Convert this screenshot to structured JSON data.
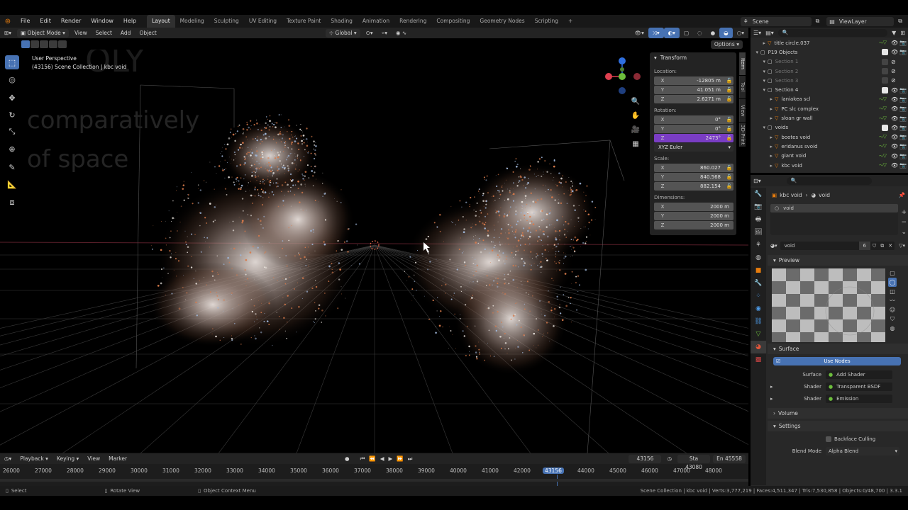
{
  "menu": [
    "File",
    "Edit",
    "Render",
    "Window",
    "Help"
  ],
  "workspaces": [
    "Layout",
    "Modeling",
    "Sculpting",
    "UV Editing",
    "Texture Paint",
    "Shading",
    "Animation",
    "Rendering",
    "Compositing",
    "Geometry Nodes",
    "Scripting",
    "+"
  ],
  "scene_name": "Scene",
  "view_layer": "ViewLayer",
  "header": {
    "mode": "Object Mode",
    "items": [
      "View",
      "Select",
      "Add",
      "Object"
    ],
    "orientation": "Global",
    "options": "Options"
  },
  "viewport": {
    "perspective": "User Perspective",
    "collection": "(43156) Scene Collection | kbc void",
    "bg_text_1": "OLY",
    "bg_text_2": "comparatively",
    "bg_text_3": "of space"
  },
  "transform": {
    "title": "Transform",
    "location_label": "Location:",
    "location": [
      {
        "ax": "X",
        "v": "-12805 m"
      },
      {
        "ax": "Y",
        "v": "41.051 m"
      },
      {
        "ax": "Z",
        "v": "2.6271 m"
      }
    ],
    "rotation_label": "Rotation:",
    "rotation": [
      {
        "ax": "X",
        "v": "0°"
      },
      {
        "ax": "Y",
        "v": "0°"
      },
      {
        "ax": "Z",
        "v": "2473°"
      }
    ],
    "rotation_mode": "XYZ Euler",
    "scale_label": "Scale:",
    "scale": [
      {
        "ax": "X",
        "v": "860.027"
      },
      {
        "ax": "Y",
        "v": "840.568"
      },
      {
        "ax": "Z",
        "v": "882.154"
      }
    ],
    "dimensions_label": "Dimensions:",
    "dimensions": [
      {
        "ax": "X",
        "v": "2000 m"
      },
      {
        "ax": "Y",
        "v": "2000 m"
      },
      {
        "ax": "Z",
        "v": "2000 m"
      }
    ]
  },
  "side_tabs": [
    "Item",
    "Tool",
    "View",
    "3D-Print"
  ],
  "outliner": [
    {
      "name": "title circle.037",
      "indent": 2,
      "dim": false
    },
    {
      "name": "P19 Objects",
      "indent": 1,
      "dim": false
    },
    {
      "name": "Section 1",
      "indent": 2,
      "dim": true
    },
    {
      "name": "Section 2",
      "indent": 2,
      "dim": true
    },
    {
      "name": "Section 3",
      "indent": 2,
      "dim": true
    },
    {
      "name": "Section 4",
      "indent": 2,
      "dim": false
    },
    {
      "name": "laniakea scl",
      "indent": 3,
      "dim": false
    },
    {
      "name": "PC slc complex",
      "indent": 3,
      "dim": false
    },
    {
      "name": "sloan gr wall",
      "indent": 3,
      "dim": false
    },
    {
      "name": "voids",
      "indent": 2,
      "dim": false
    },
    {
      "name": "bootes void",
      "indent": 3,
      "dim": false
    },
    {
      "name": "eridanus svoid",
      "indent": 3,
      "dim": false
    },
    {
      "name": "giant void",
      "indent": 3,
      "dim": false
    },
    {
      "name": "kbc void",
      "indent": 3,
      "dim": false
    }
  ],
  "props": {
    "breadcrumb_obj": "kbc void",
    "breadcrumb_mat": "void",
    "slot": "void",
    "material_name": "void",
    "users": "6",
    "preview": "Preview",
    "surface": "Surface",
    "use_nodes": "Use Nodes",
    "surface_label": "Surface",
    "surface_val": "Add Shader",
    "shader_label": "Shader",
    "shader1": "Transparent BSDF",
    "shader2": "Emission",
    "volume": "Volume",
    "settings": "Settings",
    "backface": "Backface Culling",
    "blend_label": "Blend Mode",
    "blend_val": "Alpha Blend"
  },
  "timeline": {
    "items": [
      "Playback",
      "Keying",
      "View",
      "Marker"
    ],
    "current": "43156",
    "start": "Sta 43080",
    "end": "En 45558",
    "ticks": [
      "26000",
      "27000",
      "28000",
      "29000",
      "30000",
      "31000",
      "32000",
      "33000",
      "34000",
      "35000",
      "36000",
      "37000",
      "38000",
      "39000",
      "40000",
      "41000",
      "42000",
      "43156",
      "44000",
      "45000",
      "46000",
      "47000",
      "48000"
    ]
  },
  "status": {
    "select": "Select",
    "rotate": "Rotate View",
    "context": "Object Context Menu",
    "stats": "Scene Collection | kbc void | Verts:3,777,219 | Faces:4,511,347 | Tris:7,530,858 | Objects:0/48,700 | 3.3.1"
  }
}
